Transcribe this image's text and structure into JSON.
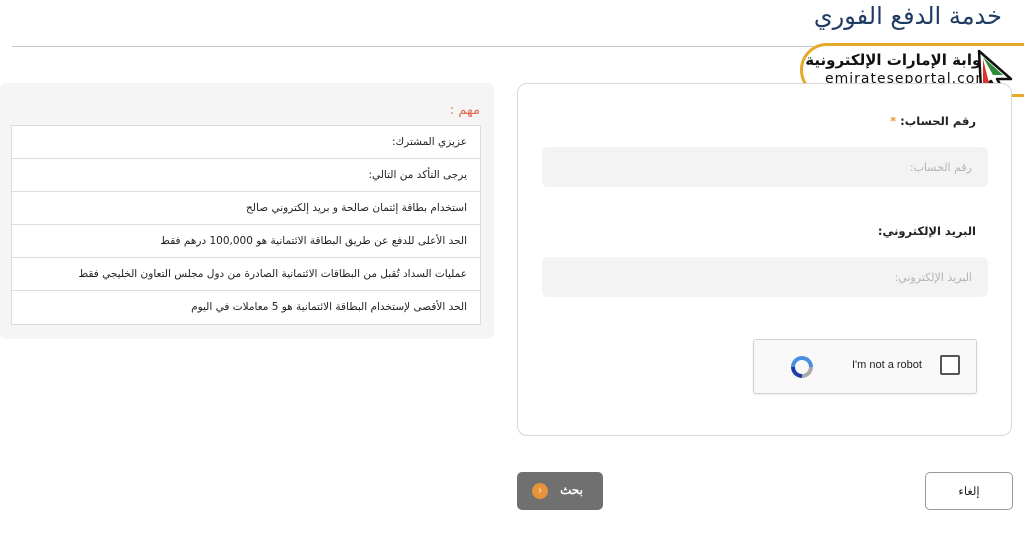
{
  "page": {
    "title": "خدمة الدفع الفوري"
  },
  "logo": {
    "arabic_name": "بوابة الإمارات الإلكترونية",
    "domain": "emirateseportal.com",
    "colors": {
      "border": "#e3a92b",
      "green": "#2e8b3a",
      "red": "#d9342b"
    }
  },
  "info": {
    "heading": "مهم :",
    "rows": [
      "عزيزي المشترك:",
      "يرجى التأكد من التالي:",
      "استخدام بطاقة إئتمان صالحة و بريد إلكتروني صالح",
      "الحد الأعلى للدفع عن طريق البطاقة الائتمانية هو 100,000 درهم فقط",
      "عمليات السداد تُقبل من البطاقات الائتمانية الصادرة من دول مجلس التعاون الخليجي فقط",
      "الحد الأقصى لإستخدام البطاقة الائتمانية هو 5 معاملات في اليوم"
    ]
  },
  "form": {
    "account": {
      "label": "رقم الحساب:",
      "required_mark": "*",
      "placeholder": "رقم الحساب:",
      "value": ""
    },
    "email": {
      "label": "البريد الإلكتروني:",
      "placeholder": "البريد الإلكتروني:",
      "value": ""
    },
    "captcha": {
      "label": "I'm not a robot",
      "checked": false
    }
  },
  "actions": {
    "search_label": "بحث",
    "search_icon": "chevron-right-icon",
    "cancel_label": "إلغاء",
    "accent_color": "#e8923a"
  }
}
